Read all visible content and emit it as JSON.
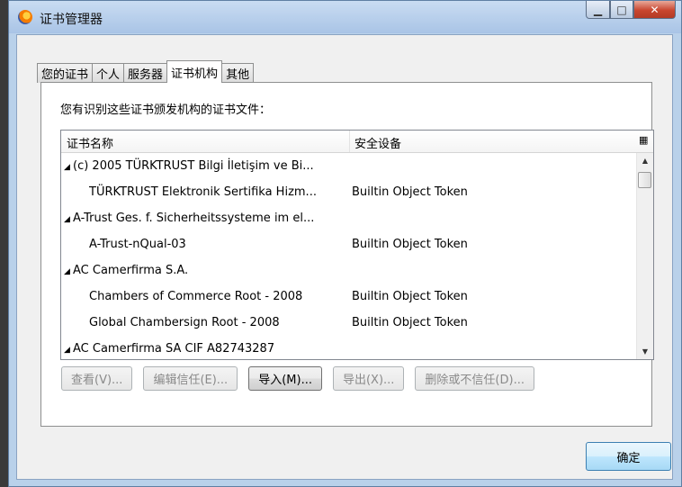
{
  "window": {
    "title": "证书管理器"
  },
  "tabs": [
    {
      "label": "您的证书",
      "active": false
    },
    {
      "label": "个人",
      "active": false
    },
    {
      "label": "服务器",
      "active": false
    },
    {
      "label": "证书机构",
      "active": true
    },
    {
      "label": "其他",
      "active": false
    }
  ],
  "panel": {
    "description": "您有识别这些证书颁发机构的证书文件：",
    "columns": {
      "name": "证书名称",
      "device": "安全设备"
    },
    "rows": [
      {
        "type": "group",
        "name": "(c) 2005 TÜRKTRUST Bilgi İletişim ve Bi...",
        "device": ""
      },
      {
        "type": "child",
        "name": "TÜRKTRUST Elektronik Sertifika Hizm...",
        "device": "Builtin Object Token"
      },
      {
        "type": "group",
        "name": "A-Trust Ges. f. Sicherheitssysteme im el...",
        "device": ""
      },
      {
        "type": "child",
        "name": "A-Trust-nQual-03",
        "device": "Builtin Object Token"
      },
      {
        "type": "group",
        "name": "AC Camerfirma S.A.",
        "device": ""
      },
      {
        "type": "child",
        "name": "Chambers of Commerce Root - 2008",
        "device": "Builtin Object Token"
      },
      {
        "type": "child",
        "name": "Global Chambersign Root - 2008",
        "device": "Builtin Object Token"
      },
      {
        "type": "group",
        "name": "AC Camerfirma SA CIF A82743287",
        "device": ""
      }
    ],
    "buttons": {
      "view": "查看(V)...",
      "edit_trust": "编辑信任(E)...",
      "import": "导入(M)...",
      "export": "导出(X)...",
      "delete": "删除或不信任(D)..."
    }
  },
  "footer": {
    "ok": "确定"
  },
  "icons": {
    "expander": "triangle-expanded-icon",
    "column_picker": "column-picker-icon",
    "app": "firefox-icon"
  }
}
